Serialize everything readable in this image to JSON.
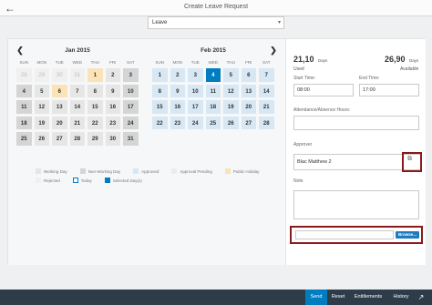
{
  "header": {
    "back_icon": "arrow-left-icon",
    "title": "Create Leave Request"
  },
  "leave_type": {
    "value": "Leave",
    "chevron_icon": "chevron-down-icon"
  },
  "calendar": {
    "prev_icon": "chevron-left-icon",
    "next_icon": "chevron-right-icon",
    "weekdays": [
      "SUN",
      "MON",
      "TUE",
      "WED",
      "THU",
      "FRI",
      "SAT"
    ],
    "months": [
      {
        "title": "Jan 2015",
        "weeks": [
          [
            {
              "d": "28",
              "t": "other"
            },
            {
              "d": "29",
              "t": "other"
            },
            {
              "d": "30",
              "t": "other"
            },
            {
              "d": "31",
              "t": "other"
            },
            {
              "d": "1",
              "t": "holiday"
            },
            {
              "d": "2",
              "t": "work"
            },
            {
              "d": "3",
              "t": "nonwork"
            }
          ],
          [
            {
              "d": "4",
              "t": "nonwork"
            },
            {
              "d": "5",
              "t": "work"
            },
            {
              "d": "6",
              "t": "holiday"
            },
            {
              "d": "7",
              "t": "work"
            },
            {
              "d": "8",
              "t": "work"
            },
            {
              "d": "9",
              "t": "work"
            },
            {
              "d": "10",
              "t": "nonwork"
            }
          ],
          [
            {
              "d": "11",
              "t": "nonwork"
            },
            {
              "d": "12",
              "t": "work"
            },
            {
              "d": "13",
              "t": "work"
            },
            {
              "d": "14",
              "t": "work"
            },
            {
              "d": "15",
              "t": "work"
            },
            {
              "d": "16",
              "t": "work"
            },
            {
              "d": "17",
              "t": "nonwork"
            }
          ],
          [
            {
              "d": "18",
              "t": "nonwork"
            },
            {
              "d": "19",
              "t": "work"
            },
            {
              "d": "20",
              "t": "work"
            },
            {
              "d": "21",
              "t": "work"
            },
            {
              "d": "22",
              "t": "work"
            },
            {
              "d": "23",
              "t": "work"
            },
            {
              "d": "24",
              "t": "nonwork"
            }
          ],
          [
            {
              "d": "25",
              "t": "nonwork"
            },
            {
              "d": "26",
              "t": "work"
            },
            {
              "d": "27",
              "t": "work"
            },
            {
              "d": "28",
              "t": "work"
            },
            {
              "d": "29",
              "t": "work"
            },
            {
              "d": "30",
              "t": "work"
            },
            {
              "d": "31",
              "t": "nonwork"
            }
          ]
        ]
      },
      {
        "title": "Feb 2015",
        "weeks": [
          [
            {
              "d": "1",
              "t": "blue"
            },
            {
              "d": "2",
              "t": "blue"
            },
            {
              "d": "3",
              "t": "blue"
            },
            {
              "d": "4",
              "t": "today-sel"
            },
            {
              "d": "5",
              "t": "blue"
            },
            {
              "d": "6",
              "t": "blue"
            },
            {
              "d": "7",
              "t": "blue"
            }
          ],
          [
            {
              "d": "8",
              "t": "blue"
            },
            {
              "d": "9",
              "t": "blue"
            },
            {
              "d": "10",
              "t": "blue"
            },
            {
              "d": "11",
              "t": "blue"
            },
            {
              "d": "12",
              "t": "blue"
            },
            {
              "d": "13",
              "t": "blue"
            },
            {
              "d": "14",
              "t": "blue"
            }
          ],
          [
            {
              "d": "15",
              "t": "blue"
            },
            {
              "d": "16",
              "t": "blue"
            },
            {
              "d": "17",
              "t": "blue"
            },
            {
              "d": "18",
              "t": "blue"
            },
            {
              "d": "19",
              "t": "blue"
            },
            {
              "d": "20",
              "t": "blue"
            },
            {
              "d": "21",
              "t": "blue"
            }
          ],
          [
            {
              "d": "22",
              "t": "blue"
            },
            {
              "d": "23",
              "t": "blue"
            },
            {
              "d": "24",
              "t": "blue"
            },
            {
              "d": "25",
              "t": "blue"
            },
            {
              "d": "26",
              "t": "blue"
            },
            {
              "d": "27",
              "t": "blue"
            },
            {
              "d": "28",
              "t": "blue"
            }
          ]
        ]
      }
    ],
    "legend": [
      [
        {
          "label": "Working Day",
          "color": "#e6e6e6"
        },
        {
          "label": "Non-Working Day",
          "color": "#d5d5d5"
        },
        {
          "label": "Approved",
          "color": "#d7e7f3"
        },
        {
          "label": "Approval Pending",
          "color": "#ececec"
        },
        {
          "label": "Public Holiday",
          "color": "#fbe3b8"
        }
      ],
      [
        {
          "label": "Rejected",
          "color": "#f0f0f0"
        },
        {
          "label": "Today",
          "color": "#ffffff",
          "border": "#007cc0"
        },
        {
          "label": "Selected Day(s)",
          "color": "#007cc0"
        }
      ]
    ]
  },
  "summary": {
    "used_value": "21,10",
    "used_unit": "Days",
    "used_label": "Used",
    "available_value": "26,90",
    "available_unit": "Days",
    "available_label": "Available"
  },
  "form": {
    "start_time_label": "Start Time:",
    "start_time_value": "08:00",
    "end_time_label": "End Time:",
    "end_time_value": "17:00",
    "hours_label": "Attendance/Absence Hours:",
    "approver_label": "Approver",
    "approver_value": "Blac Matthew 2",
    "approver_icon": "copy-icon",
    "note_label": "Note",
    "browse_label": "Browse..."
  },
  "footer": {
    "send": "Send",
    "reset": "Reset",
    "entitlements": "Entitlements",
    "history": "History",
    "share_icon": "share-icon"
  },
  "colors": {
    "accent": "#007cc0",
    "highlight_box": "#8b1a1a",
    "footer_bg": "#2e3c4a"
  }
}
